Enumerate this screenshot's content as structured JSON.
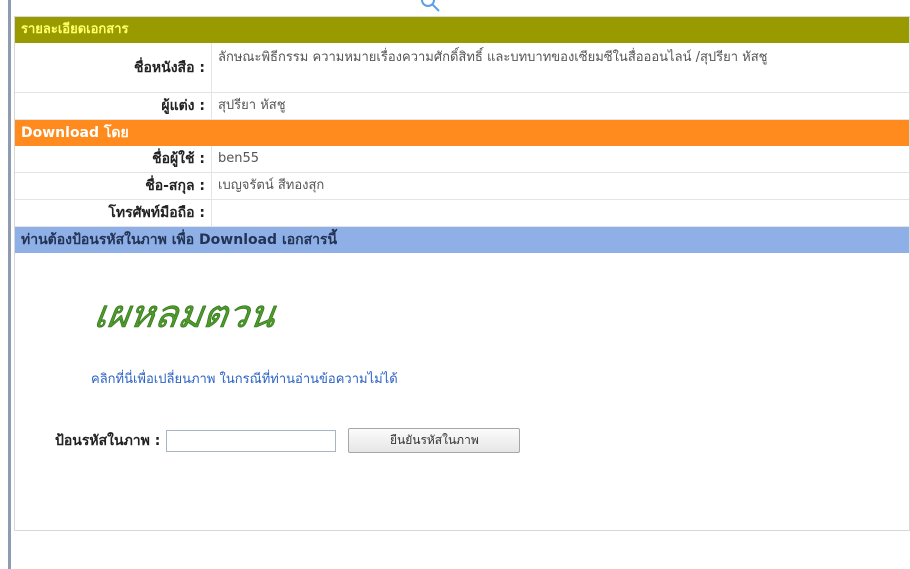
{
  "details": {
    "header": "รายละเอียดเอกสาร",
    "book_label": "ชื่อหนังสือ :",
    "book_title": "ลักษณะพิธีกรรม ความหมายเรื่องความศักดิ์สิทธิ์ และบทบาทของเซียมซีในสื่อออนไลน์ /สุปรียา หัสชู",
    "author_label": "ผู้แต่ง :",
    "author": "สุปรียา หัสชู"
  },
  "downloader": {
    "header": "Download โดย",
    "username_label": "ชื่อผู้ใช้ :",
    "username": "ben55",
    "fullname_label": "ชื่อ-สกุล :",
    "fullname": "เบญจรัตน์ สีทองสุก",
    "phone_label": "โทรศัพท์มือถือ :",
    "phone": ""
  },
  "captcha": {
    "header": "ท่านต้องป้อนรหัสในภาพ เพื่อ Download เอกสารนี้",
    "image_text": "เผหลมตวน",
    "change_link": "คลิกที่นี่เพื่อเปลี่ยนภาพ ในกรณีที่ท่านอ่านข้อความไม่ได้",
    "code_label": "ป้อนรหัสในภาพ :",
    "code_value": "",
    "confirm_button": "ยืนยันรหัสในภาพ"
  },
  "colors": {
    "olive_header": "#999900",
    "orange_header": "#ff8b1f",
    "blue_header": "#8fb0e6",
    "link": "#2b62c4"
  }
}
